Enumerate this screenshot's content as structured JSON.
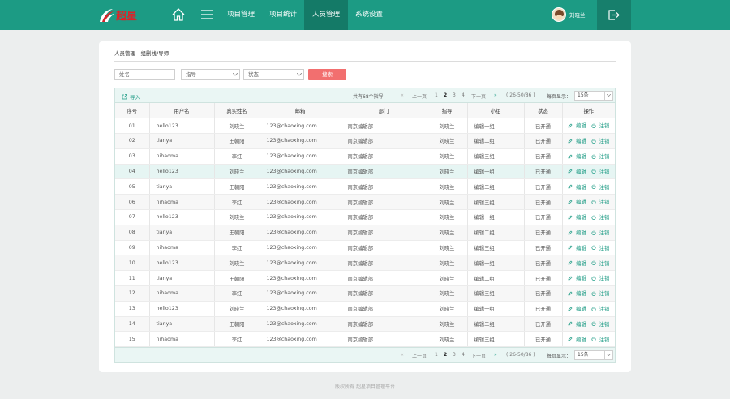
{
  "header": {
    "logo_text": "超星",
    "nav": [
      "项目管理",
      "项目统计",
      "人员管理",
      "系统设置"
    ],
    "active_nav": "人员管理",
    "user_name": "刘晓兰"
  },
  "breadcrumb": "人员管理—组删栈/导师",
  "filters": {
    "name_placeholder": "姓名",
    "role_value": "指导",
    "status_value": "状态",
    "search_label": "搜索"
  },
  "toolbar": {
    "import_label": "导入",
    "total_text": "共有68个指导",
    "prev_label": "上一页",
    "next_label": "下一页",
    "pages": [
      "1",
      "2",
      "3",
      "4"
    ],
    "current_page": "2",
    "range_text": "( 26-50/86 )",
    "per_page_label": "每页显示：",
    "per_page_value": "15条"
  },
  "table": {
    "columns": [
      "序号",
      "用户名",
      "真实姓名",
      "邮箱",
      "部门",
      "指导",
      "小组",
      "状态",
      "操作"
    ],
    "rows": [
      [
        "01",
        "hello123",
        "刘晓兰",
        "123@chaoxing.com",
        "南京编辑部",
        "刘晓兰",
        "编辑一组",
        "已开通"
      ],
      [
        "02",
        "tianya",
        "王朝阳",
        "123@chaoxing.com",
        "南京编辑部",
        "刘晓兰",
        "编辑二组",
        "已开通"
      ],
      [
        "03",
        "nihaoma",
        "李红",
        "123@chaoxing.com",
        "南京编辑部",
        "刘晓兰",
        "编辑三组",
        "已开通"
      ],
      [
        "04",
        "hello123",
        "刘晓兰",
        "123@chaoxing.com",
        "南京编辑部",
        "刘晓兰",
        "编辑一组",
        "已开通"
      ],
      [
        "05",
        "tianya",
        "王朝阳",
        "123@chaoxing.com",
        "南京编辑部",
        "刘晓兰",
        "编辑二组",
        "已开通"
      ],
      [
        "06",
        "nihaoma",
        "李红",
        "123@chaoxing.com",
        "南京编辑部",
        "刘晓兰",
        "编辑三组",
        "已开通"
      ],
      [
        "07",
        "hello123",
        "刘晓兰",
        "123@chaoxing.com",
        "南京编辑部",
        "刘晓兰",
        "编辑一组",
        "已开通"
      ],
      [
        "08",
        "tianya",
        "王朝阳",
        "123@chaoxing.com",
        "南京编辑部",
        "刘晓兰",
        "编辑二组",
        "已开通"
      ],
      [
        "09",
        "nihaoma",
        "李红",
        "123@chaoxing.com",
        "南京编辑部",
        "刘晓兰",
        "编辑三组",
        "已开通"
      ],
      [
        "10",
        "hello123",
        "刘晓兰",
        "123@chaoxing.com",
        "南京编辑部",
        "刘晓兰",
        "编辑一组",
        "已开通"
      ],
      [
        "11",
        "tianya",
        "王朝阳",
        "123@chaoxing.com",
        "南京编辑部",
        "刘晓兰",
        "编辑二组",
        "已开通"
      ],
      [
        "12",
        "nihaoma",
        "李红",
        "123@chaoxing.com",
        "南京编辑部",
        "刘晓兰",
        "编辑三组",
        "已开通"
      ],
      [
        "13",
        "hello123",
        "刘晓兰",
        "123@chaoxing.com",
        "南京编辑部",
        "刘晓兰",
        "编辑一组",
        "已开通"
      ],
      [
        "14",
        "tianya",
        "王朝阳",
        "123@chaoxing.com",
        "南京编辑部",
        "刘晓兰",
        "编辑二组",
        "已开通"
      ],
      [
        "15",
        "nihaoma",
        "李红",
        "123@chaoxing.com",
        "南京编辑部",
        "刘晓兰",
        "编辑三组",
        "已开通"
      ]
    ],
    "edit_label": "编辑",
    "cancel_label": "注销",
    "highlighted_row": "04"
  },
  "footer": "版权所有  超星项目管理平台",
  "colors": {
    "brand": "#1c9b84",
    "search_button": "#f26f6f",
    "logo_red": "#d8262b"
  }
}
